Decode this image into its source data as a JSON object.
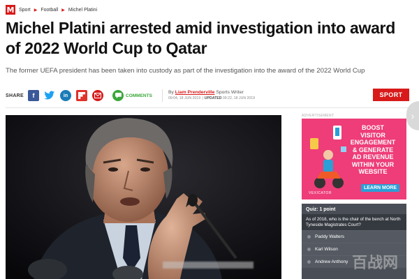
{
  "breadcrumb": {
    "logo": "M",
    "items": [
      "Sport",
      "Football",
      "Michel Platini"
    ]
  },
  "article": {
    "headline": "Michel Platini arrested amid investigation into award of 2022 World Cup to Qatar",
    "standfirst": "The former UEFA president has been taken into custody as part of the investigation into the award of the 2022 World Cup",
    "share_label": "SHARE",
    "comments_label": "COMMENTS",
    "byline": {
      "prefix": "By",
      "author": "Liam Prenderville",
      "role": "Sports Writer",
      "published": "09:04, 18 JUN 2019",
      "updated_label": "UPDATED",
      "updated": "09:22, 18 JUN 2019"
    },
    "section_badge": "SPORT"
  },
  "sidebar": {
    "advert_label": "ADVERTISEMENT",
    "ad": {
      "lines": [
        "BOOST",
        "VISITOR",
        "ENGAGEMENT",
        "& GENERATE",
        "AD REVENUE",
        "WITHIN YOUR",
        "WEBSITE"
      ],
      "button": "LEARN MORE",
      "brand": "VEXICATOR"
    },
    "quiz": {
      "header": "Quiz: 1 point",
      "question": "As of 2018, who is the chair of the bench at North Tyneside Magistrates Court?",
      "options": [
        "Paddy Walters",
        "Karl Wilson",
        "Andrew Anthony"
      ]
    }
  },
  "icons": {
    "facebook": "facebook-icon",
    "twitter": "twitter-icon",
    "linkedin": "linkedin-icon",
    "flipboard": "flipboard-icon",
    "email": "email-icon",
    "comments": "comment-bubble-icon",
    "next": "chevron-right-icon"
  },
  "colors": {
    "brand_red": "#d81a1a",
    "ad_pink": "#ee3d78",
    "quiz_grey": "#4a4f57",
    "comments_green": "#3aa83a"
  }
}
